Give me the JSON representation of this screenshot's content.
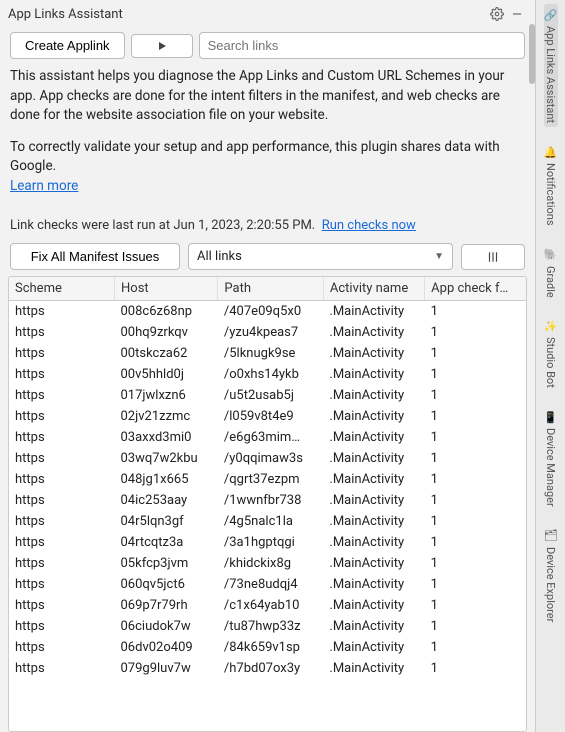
{
  "titlebar": {
    "title": "App Links Assistant"
  },
  "toolbar": {
    "create_label": "Create Applink",
    "search_placeholder": "Search links"
  },
  "desc": {
    "p1": "This assistant helps you diagnose the App Links and Custom URL Schemes in your app. App checks are done for the intent filters in the manifest, and web checks are done for the website association file on your website.",
    "p2": "To correctly validate your setup and app performance, this plugin shares data with Google.",
    "learn_more": "Learn more"
  },
  "runline": {
    "prefix": "Link checks were last run at ",
    "timestamp": "Jun 1, 2023, 2:20:55 PM.",
    "run_now": "Run checks now"
  },
  "controls": {
    "fix_label": "Fix All Manifest Issues",
    "filter_label": "All links"
  },
  "table": {
    "headers": {
      "scheme": "Scheme",
      "host": "Host",
      "path": "Path",
      "activity": "Activity name",
      "appcheck": "App check f…"
    },
    "rows": [
      {
        "scheme": "https",
        "host": "008c6z68np",
        "path": "/407e09q5x0",
        "activity": ".MainActivity",
        "flag": "1"
      },
      {
        "scheme": "https",
        "host": "00hq9zrkqv",
        "path": "/yzu4kpeas7",
        "activity": ".MainActivity",
        "flag": "1"
      },
      {
        "scheme": "https",
        "host": "00tskcza62",
        "path": "/5lknugk9se",
        "activity": ".MainActivity",
        "flag": "1"
      },
      {
        "scheme": "https",
        "host": "00v5hhld0j",
        "path": "/o0xhs14ykb",
        "activity": ".MainActivity",
        "flag": "1"
      },
      {
        "scheme": "https",
        "host": "017jwlxzn6",
        "path": "/u5t2usab5j",
        "activity": ".MainActivity",
        "flag": "1"
      },
      {
        "scheme": "https",
        "host": "02jv21zzmc",
        "path": "/l059v8t4e9",
        "activity": ".MainActivity",
        "flag": "1"
      },
      {
        "scheme": "https",
        "host": "03axxd3mi0",
        "path": "/e6g63mim…",
        "activity": ".MainActivity",
        "flag": "1"
      },
      {
        "scheme": "https",
        "host": "03wq7w2kbu",
        "path": "/y0qqimaw3s",
        "activity": ".MainActivity",
        "flag": "1"
      },
      {
        "scheme": "https",
        "host": "048jg1x665",
        "path": "/qgrt37ezpm",
        "activity": ".MainActivity",
        "flag": "1"
      },
      {
        "scheme": "https",
        "host": "04ic253aay",
        "path": "/1wwnfbr738",
        "activity": ".MainActivity",
        "flag": "1"
      },
      {
        "scheme": "https",
        "host": "04r5lqn3gf",
        "path": "/4g5nalc1la",
        "activity": ".MainActivity",
        "flag": "1"
      },
      {
        "scheme": "https",
        "host": "04rtcqtz3a",
        "path": "/3a1hgptqgi",
        "activity": ".MainActivity",
        "flag": "1"
      },
      {
        "scheme": "https",
        "host": "05kfcp3jvm",
        "path": "/khidckix8g",
        "activity": ".MainActivity",
        "flag": "1"
      },
      {
        "scheme": "https",
        "host": "060qv5jct6",
        "path": "/73ne8udqj4",
        "activity": ".MainActivity",
        "flag": "1"
      },
      {
        "scheme": "https",
        "host": "069p7r79rh",
        "path": "/c1x64yab10",
        "activity": ".MainActivity",
        "flag": "1"
      },
      {
        "scheme": "https",
        "host": "06ciudok7w",
        "path": "/tu87hwp33z",
        "activity": ".MainActivity",
        "flag": "1"
      },
      {
        "scheme": "https",
        "host": "06dv02o409",
        "path": "/84k659v1sp",
        "activity": ".MainActivity",
        "flag": "1"
      },
      {
        "scheme": "https",
        "host": "079g9luv7w",
        "path": "/h7bd07ox3y",
        "activity": ".MainActivity",
        "flag": "1"
      }
    ]
  },
  "rail": {
    "items": [
      {
        "label": "App Links Assistant",
        "icon": "🔗",
        "active": true
      },
      {
        "label": "Notifications",
        "icon": "🔔",
        "active": false
      },
      {
        "label": "Gradle",
        "icon": "🐘",
        "active": false
      },
      {
        "label": "Studio Bot",
        "icon": "✨",
        "active": false
      },
      {
        "label": "Device Manager",
        "icon": "📱",
        "active": false
      },
      {
        "label": "Device Explorer",
        "icon": "🗂",
        "active": false
      }
    ]
  }
}
